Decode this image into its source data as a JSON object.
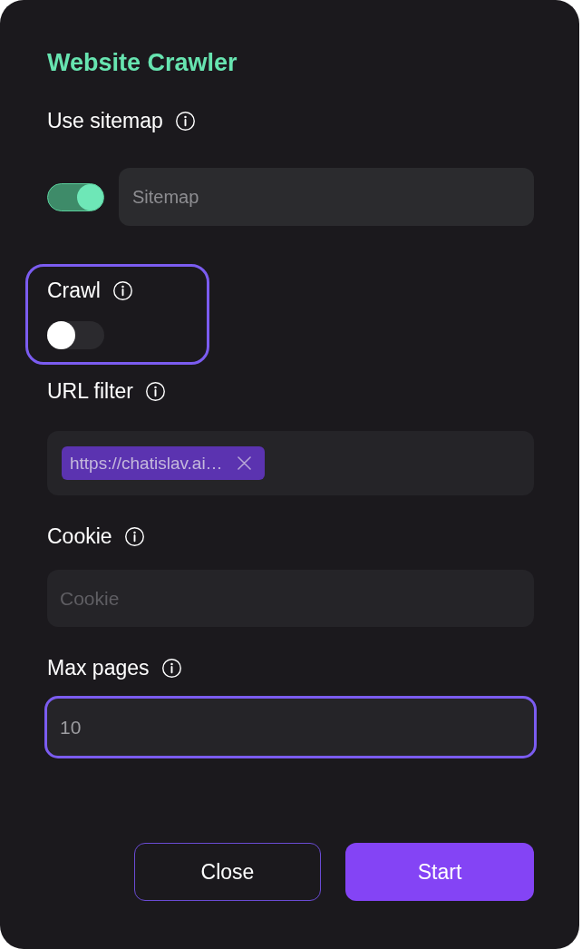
{
  "title": "Website Crawler",
  "fields": [
    {
      "kind": "toggle_input",
      "label": "Use sitemap",
      "on": true,
      "placeholder": "Sitemap"
    },
    {
      "kind": "toggle",
      "label": "Crawl",
      "on": false,
      "focused": true
    },
    {
      "kind": "tags",
      "label": "URL filter",
      "tags": [
        {
          "text": "https://chatislav.ai…"
        }
      ]
    },
    {
      "kind": "text",
      "label": "Cookie",
      "placeholder": "Cookie",
      "focused": false
    },
    {
      "kind": "text",
      "label": "Max pages",
      "value": "10",
      "focused": true
    }
  ],
  "buttons": [
    {
      "label": "Close",
      "kind": "secondary"
    },
    {
      "label": "Start",
      "kind": "primary"
    }
  ]
}
